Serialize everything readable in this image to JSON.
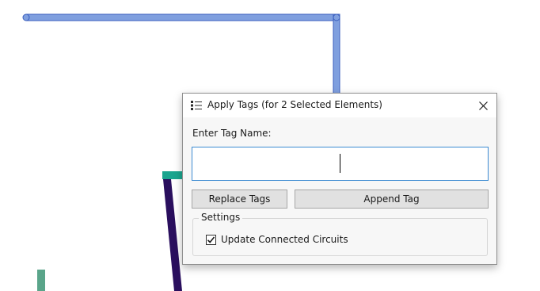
{
  "dialog": {
    "title": "Apply Tags (for 2 Selected Elements)",
    "title_icon": "list-icon",
    "close_icon": "close-icon",
    "prompt_label": "Enter Tag Name:",
    "tag_input": {
      "value": "",
      "placeholder": ""
    },
    "buttons": {
      "replace_label": "Replace Tags",
      "append_label": "Append Tag"
    },
    "settings": {
      "legend": "Settings",
      "update_connected_circuits": {
        "label": "Update Connected Circuits",
        "checked": true
      }
    }
  },
  "colors": {
    "wire_blue": "#7f9fdf",
    "wire_teal": "#1aa58f",
    "wire_purple": "#2a0f5e",
    "wire_green": "#5aa58a",
    "input_focus": "#3c8bd2"
  }
}
